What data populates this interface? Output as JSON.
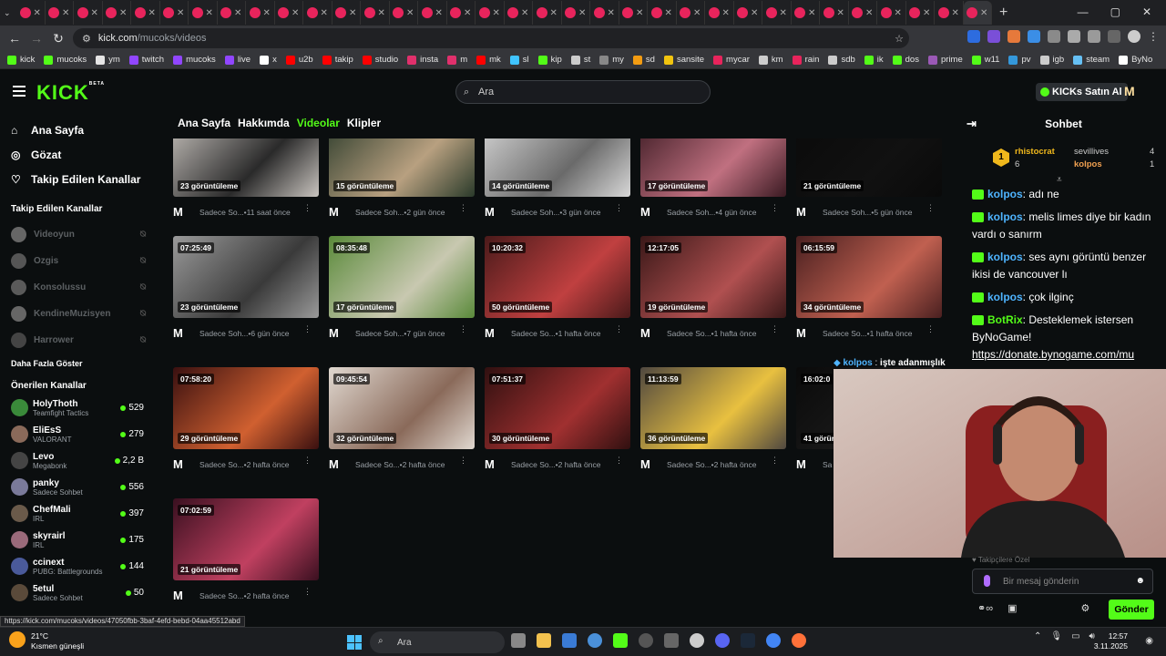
{
  "browser": {
    "url_host": "kick.com",
    "url_path": "/mucoks/videos",
    "tab_count": 34,
    "bookmarks": [
      {
        "label": "kick",
        "color": "#53fc18"
      },
      {
        "label": "mucoks",
        "color": "#53fc18"
      },
      {
        "label": "ym",
        "color": "#e5e5e5"
      },
      {
        "label": "twitch",
        "color": "#9146ff"
      },
      {
        "label": "mucoks",
        "color": "#9146ff"
      },
      {
        "label": "live",
        "color": "#9146ff"
      },
      {
        "label": "x",
        "color": "#ffffff"
      },
      {
        "label": "u2b",
        "color": "#ff0000"
      },
      {
        "label": "takip",
        "color": "#ff0000"
      },
      {
        "label": "studio",
        "color": "#ff0000"
      },
      {
        "label": "insta",
        "color": "#e1306c"
      },
      {
        "label": "m",
        "color": "#e1306c"
      },
      {
        "label": "mk",
        "color": "#ff0000"
      },
      {
        "label": "sl",
        "color": "#40c4ff"
      },
      {
        "label": "kip",
        "color": "#53fc18"
      },
      {
        "label": "st",
        "color": "#cccccc"
      },
      {
        "label": "my",
        "color": "#888888"
      },
      {
        "label": "sd",
        "color": "#f39c12"
      },
      {
        "label": "sansite",
        "color": "#f1c40f"
      },
      {
        "label": "mycar",
        "color": "#e8245c"
      },
      {
        "label": "km",
        "color": "#cccccc"
      },
      {
        "label": "rain",
        "color": "#e8245c"
      },
      {
        "label": "sdb",
        "color": "#cccccc"
      },
      {
        "label": "ik",
        "color": "#53fc18"
      },
      {
        "label": "dos",
        "color": "#53fc18"
      },
      {
        "label": "prime",
        "color": "#9b59b6"
      },
      {
        "label": "w11",
        "color": "#53fc18"
      },
      {
        "label": "pv",
        "color": "#3498db"
      },
      {
        "label": "igb",
        "color": "#cccccc"
      },
      {
        "label": "steam",
        "color": "#66c0f4"
      },
      {
        "label": "ByNo",
        "color": "#ffffff"
      }
    ],
    "status_url": "https://kick.com/mucoks/videos/47050fbb-3baf-4efd-bebd-04aa45512abd"
  },
  "header": {
    "logo": "KICK",
    "logo_beta": "BETA",
    "search_placeholder": "Ara",
    "buy_kicks": "KICKs Satın Al"
  },
  "sidebar": {
    "nav": [
      {
        "label": "Ana Sayfa",
        "icon": "home-icon",
        "glyph": "⌂"
      },
      {
        "label": "Gözat",
        "icon": "compass-icon",
        "glyph": "◎"
      },
      {
        "label": "Takip Edilen Kanallar",
        "icon": "heart-icon",
        "glyph": "♡"
      }
    ],
    "followed_title": "Takip Edilen Kanallar",
    "followed": [
      {
        "name": "Videoyun",
        "color": "#666"
      },
      {
        "name": "Ozgis",
        "color": "#555"
      },
      {
        "name": "Konsolussu",
        "color": "#5a5a5a"
      },
      {
        "name": "KendineMuzisyen",
        "color": "#666"
      },
      {
        "name": "Harrower",
        "color": "#444"
      }
    ],
    "show_more": "Daha Fazla Göster",
    "recommended_title": "Önerilen Kanallar",
    "recommended": [
      {
        "name": "HolyThoth",
        "game": "Teamfight Tactics",
        "viewers": "529",
        "color": "#3a8a3a"
      },
      {
        "name": "EliEsS",
        "game": "VALORANT",
        "viewers": "279",
        "color": "#8a6a5a"
      },
      {
        "name": "Levo",
        "game": "Megabonk",
        "viewers": "2,2 B",
        "color": "#444"
      },
      {
        "name": "panky",
        "game": "Sadece Sohbet",
        "viewers": "556",
        "color": "#7a7a9a"
      },
      {
        "name": "ChefMali",
        "game": "IRL",
        "viewers": "397",
        "color": "#6a5a4a"
      },
      {
        "name": "skyrairl",
        "game": "IRL",
        "viewers": "175",
        "color": "#9a6a7a"
      },
      {
        "name": "ccinext",
        "game": "PUBG: Battlegrounds",
        "viewers": "144",
        "color": "#4a5a9a"
      },
      {
        "name": "5etul",
        "game": "Sadece Sohbet",
        "viewers": "50",
        "color": "#5a4a3a"
      }
    ]
  },
  "profile_tabs": [
    {
      "label": "Ana Sayfa",
      "active": false
    },
    {
      "label": "Hakkımda",
      "active": false
    },
    {
      "label": "Videolar",
      "active": true
    },
    {
      "label": "Klipler",
      "active": false
    }
  ],
  "videos": [
    {
      "duration": "",
      "views": "23 görüntüleme",
      "title": "Sadece So...",
      "age": "11 saat önce",
      "c1": "#c9c4bf",
      "c2": "#2a2a2a"
    },
    {
      "duration": "",
      "views": "15 görüntüleme",
      "title": "Sadece Soh...",
      "age": "2 gün önce",
      "c1": "#2a3a2a",
      "c2": "#b8a080"
    },
    {
      "duration": "",
      "views": "14 görüntüleme",
      "title": "Sadece Soh...",
      "age": "3 gün önce",
      "c1": "#d8d8d8",
      "c2": "#6a6a6a"
    },
    {
      "duration": "",
      "views": "17 görüntüleme",
      "title": "Sadece Soh...",
      "age": "4 gün önce",
      "c1": "#3a1a22",
      "c2": "#c07080"
    },
    {
      "duration": "",
      "views": "21 görüntüleme",
      "title": "Sadece Soh...",
      "age": "5 gün önce",
      "c1": "#0a0a0a",
      "c2": "#111"
    },
    {
      "duration": "07:25:49",
      "views": "23 görüntüleme",
      "title": "Sadece Soh...",
      "age": "6 gün önce",
      "c1": "#9a9a9a",
      "c2": "#3a3a3a"
    },
    {
      "duration": "08:35:48",
      "views": "17 görüntüleme",
      "title": "Sadece Soh...",
      "age": "7 gün önce",
      "c1": "#5a8a3a",
      "c2": "#c8c8b0"
    },
    {
      "duration": "10:20:32",
      "views": "50 görüntüleme",
      "title": "Sadece So...",
      "age": "1 hafta önce",
      "c1": "#4a1a1a",
      "c2": "#c04040"
    },
    {
      "duration": "12:17:05",
      "views": "19 görüntüleme",
      "title": "Sadece So...",
      "age": "1 hafta önce",
      "c1": "#3a1818",
      "c2": "#b05050"
    },
    {
      "duration": "06:15:59",
      "views": "34 görüntüleme",
      "title": "Sadece So...",
      "age": "1 hafta önce",
      "c1": "#4a2020",
      "c2": "#c06050"
    },
    {
      "duration": "07:58:20",
      "views": "29 görüntüleme",
      "title": "Sadece So...",
      "age": "2 hafta önce",
      "c1": "#3a1010",
      "c2": "#d06030"
    },
    {
      "duration": "09:45:54",
      "views": "32 görüntüleme",
      "title": "Sadece So...",
      "age": "2 hafta önce",
      "c1": "#e0d8d0",
      "c2": "#8a6a5a"
    },
    {
      "duration": "07:51:37",
      "views": "30 görüntüleme",
      "title": "Sadece So...",
      "age": "2 hafta önce",
      "c1": "#301010",
      "c2": "#a03030"
    },
    {
      "duration": "11:13:59",
      "views": "36 görüntüleme",
      "title": "Sadece So...",
      "age": "2 hafta önce",
      "c1": "#504840",
      "c2": "#e8c040"
    },
    {
      "duration": "16:02:0",
      "views": "41 görür",
      "title": "Sa",
      "age": "",
      "c1": "#0a0a0a",
      "c2": "#1a1a1a"
    },
    {
      "duration": "07:02:59",
      "views": "21 görüntüleme",
      "title": "Sadece So...",
      "age": "2 hafta önce",
      "c1": "#3a1020",
      "c2": "#c04060"
    }
  ],
  "chat": {
    "title": "Sohbet",
    "leaderboard": [
      {
        "name": "rhistocrat",
        "count": "6"
      },
      {
        "name": "sevillives",
        "count": "4"
      },
      {
        "name": "kolpos",
        "count": "1"
      }
    ],
    "messages": [
      {
        "user": "kolpos",
        "text": "adı ne",
        "color": "#4eb4ff"
      },
      {
        "user": "kolpos",
        "text": "melis limes diye bir kadın vardı o sanırm",
        "color": "#4eb4ff"
      },
      {
        "user": "kolpos",
        "text": "ses aynı görüntü benzer ikisi de vancouver lı",
        "color": "#4eb4ff"
      },
      {
        "user": "kolpos",
        "text": "çok ilginç",
        "color": "#4eb4ff"
      },
      {
        "user": "BotRix",
        "text": "Desteklemek istersen ByNoGame!",
        "color": "#53fc18",
        "link": "https://donate.bynogame.com/mu"
      }
    ],
    "pinned_user": "kolpos",
    "pinned_text": "işte adanmışlık",
    "sub_only": "Takipçilere Özel",
    "input_placeholder": "Bir mesaj gönderin",
    "send_label": "Gönder"
  },
  "taskbar": {
    "temp": "21°C",
    "weather": "Kısmen güneşli",
    "search": "Ara",
    "time": "12:57",
    "date": "3.11.2025"
  }
}
